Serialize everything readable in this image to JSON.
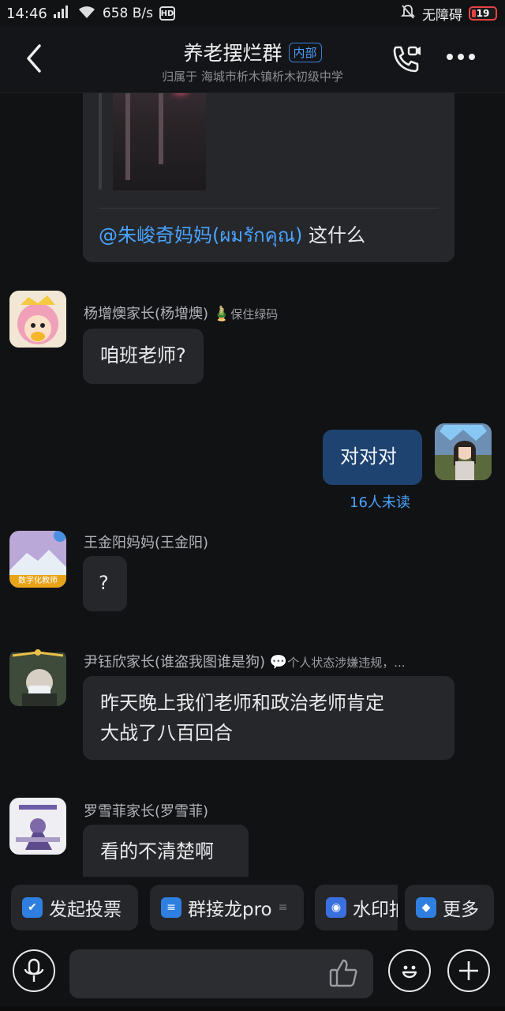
{
  "status_bar": {
    "time": "14:46",
    "network": "658 B/s",
    "hd": "HD",
    "accessibility": "无障碍",
    "battery": "19"
  },
  "header": {
    "title": "养老摆烂群",
    "badge": "内部",
    "subtitle": "归属于 海城市析木镇析木初级中学"
  },
  "messages": {
    "quote": {
      "mention": "@朱峻奇妈妈(ผมรักคุณ)",
      "text": " 这什么"
    },
    "m1": {
      "sender": "杨增燠家长(杨增燠)",
      "status": "保住绿码",
      "text": "咱班老师?"
    },
    "m2": {
      "text": "对对对",
      "unread": "16人未读"
    },
    "m3": {
      "sender": "王金阳妈妈(王金阳)",
      "avatar_label": "数字化教师",
      "text": "?"
    },
    "m4": {
      "sender": "尹钰欣家长(谁盗我图谁是狗)",
      "status": "个人状态涉嫌违规，...",
      "text_line1": "昨天晚上我们老师和政治老师肯定",
      "text_line2": "大战了八百回合"
    },
    "m5": {
      "sender": "罗雪菲家长(罗雪菲)",
      "text": "看的不清楚啊"
    }
  },
  "quick_actions": [
    {
      "label": "发起投票",
      "icon": "vote-icon",
      "color": "#2f7fe0"
    },
    {
      "label": "群接龙pro",
      "icon": "solitaire-icon",
      "color": "#2f7fe0"
    },
    {
      "label": "水印拍",
      "icon": "camera-icon",
      "color": "#3a6fe0"
    },
    {
      "label": "更多",
      "icon": "more-apps-icon",
      "color": "#2f7fe0"
    }
  ],
  "input": {
    "placeholder": ""
  }
}
